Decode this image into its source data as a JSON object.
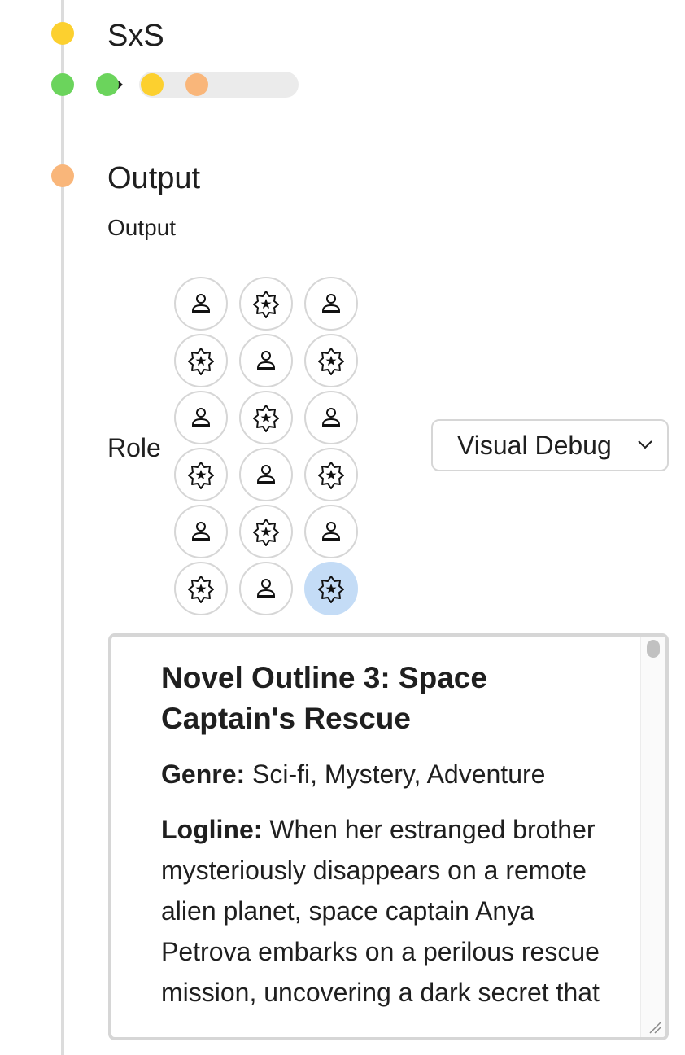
{
  "sections": {
    "sxs": {
      "title": "SxS",
      "dot_color": "#fcd02f",
      "status_dots": [
        "#6bd45c",
        "#6bd45c",
        "#fcd02f",
        "#f9b67a"
      ]
    },
    "output": {
      "title": "Output",
      "dot_color": "#f9b67a",
      "label": "Output"
    }
  },
  "role": {
    "label": "Role",
    "buttons": [
      {
        "icon": "user-icon",
        "selected": false
      },
      {
        "icon": "model-star-icon",
        "selected": false
      },
      {
        "icon": "user-icon",
        "selected": false
      },
      {
        "icon": "model-star-icon",
        "selected": false
      },
      {
        "icon": "user-icon",
        "selected": false
      },
      {
        "icon": "model-star-icon",
        "selected": false
      },
      {
        "icon": "user-icon",
        "selected": false
      },
      {
        "icon": "model-star-icon",
        "selected": false
      },
      {
        "icon": "user-icon",
        "selected": false
      },
      {
        "icon": "model-star-icon",
        "selected": false
      },
      {
        "icon": "user-icon",
        "selected": false
      },
      {
        "icon": "model-star-icon",
        "selected": false
      },
      {
        "icon": "user-icon",
        "selected": false
      },
      {
        "icon": "model-star-icon",
        "selected": false
      },
      {
        "icon": "user-icon",
        "selected": false
      },
      {
        "icon": "model-star-icon",
        "selected": false
      },
      {
        "icon": "user-icon",
        "selected": false
      },
      {
        "icon": "model-star-icon",
        "selected": true
      }
    ]
  },
  "view_select": {
    "value": "Visual Debug"
  },
  "output_panel": {
    "heading": "Novel Outline 3: Space Captain's Rescue",
    "genre_label": "Genre:",
    "genre_value": " Sci-fi, Mystery, Adventure",
    "logline_label": "Logline:",
    "logline_value": " When her estranged brother mysteriously disappears on a remote alien planet, space captain Anya Petrova embarks on a perilous rescue mission, uncovering a dark secret that"
  },
  "colors": {
    "selected_role": "#c4dcf6",
    "timeline": "#dcdcdc"
  }
}
